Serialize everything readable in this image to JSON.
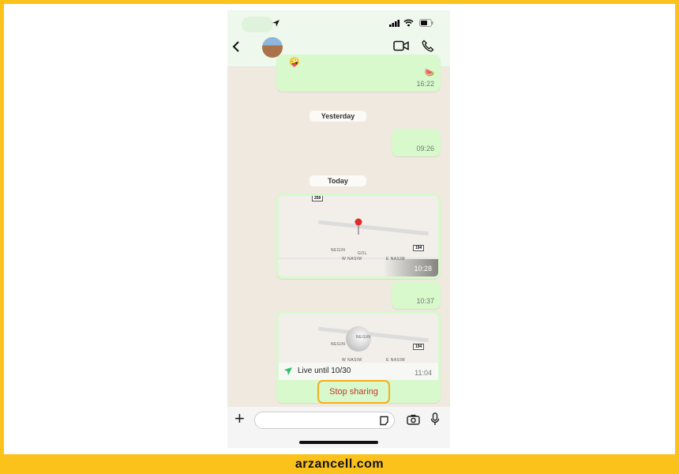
{
  "header": {
    "back_icon": "chevron-left-icon",
    "video_icon": "video-camera-icon",
    "call_icon": "phone-icon"
  },
  "status_bar": {
    "location_icon": "location-arrow-icon",
    "signal_icon": "signal-icon",
    "wifi_icon": "wifi-icon",
    "battery_icon": "battery-icon"
  },
  "messages": [
    {
      "time": "16:22"
    },
    {
      "date": "Yesterday"
    },
    {
      "time": "09:26"
    },
    {
      "date": "Today"
    },
    {
      "type": "location",
      "labels": [
        "NEGIN",
        "GOL",
        "W NASIM",
        "E NASIM"
      ],
      "shields": [
        "259",
        "194"
      ],
      "time": "10:28"
    },
    {
      "time": "10:37"
    },
    {
      "type": "live-location",
      "labels": [
        "NEGIN",
        "NEGIN",
        "W NASIM",
        "E NASIM"
      ],
      "shield": "194",
      "live_text": "Live until 10/30",
      "time": "11:04",
      "stop_label": "Stop sharing"
    }
  ],
  "colors": {
    "bubble": "#d7f9cc",
    "stop": "#c0392b",
    "highlight": "#f6ae1f",
    "frame": "#fbc21c"
  },
  "watermark": "arzancell.com"
}
